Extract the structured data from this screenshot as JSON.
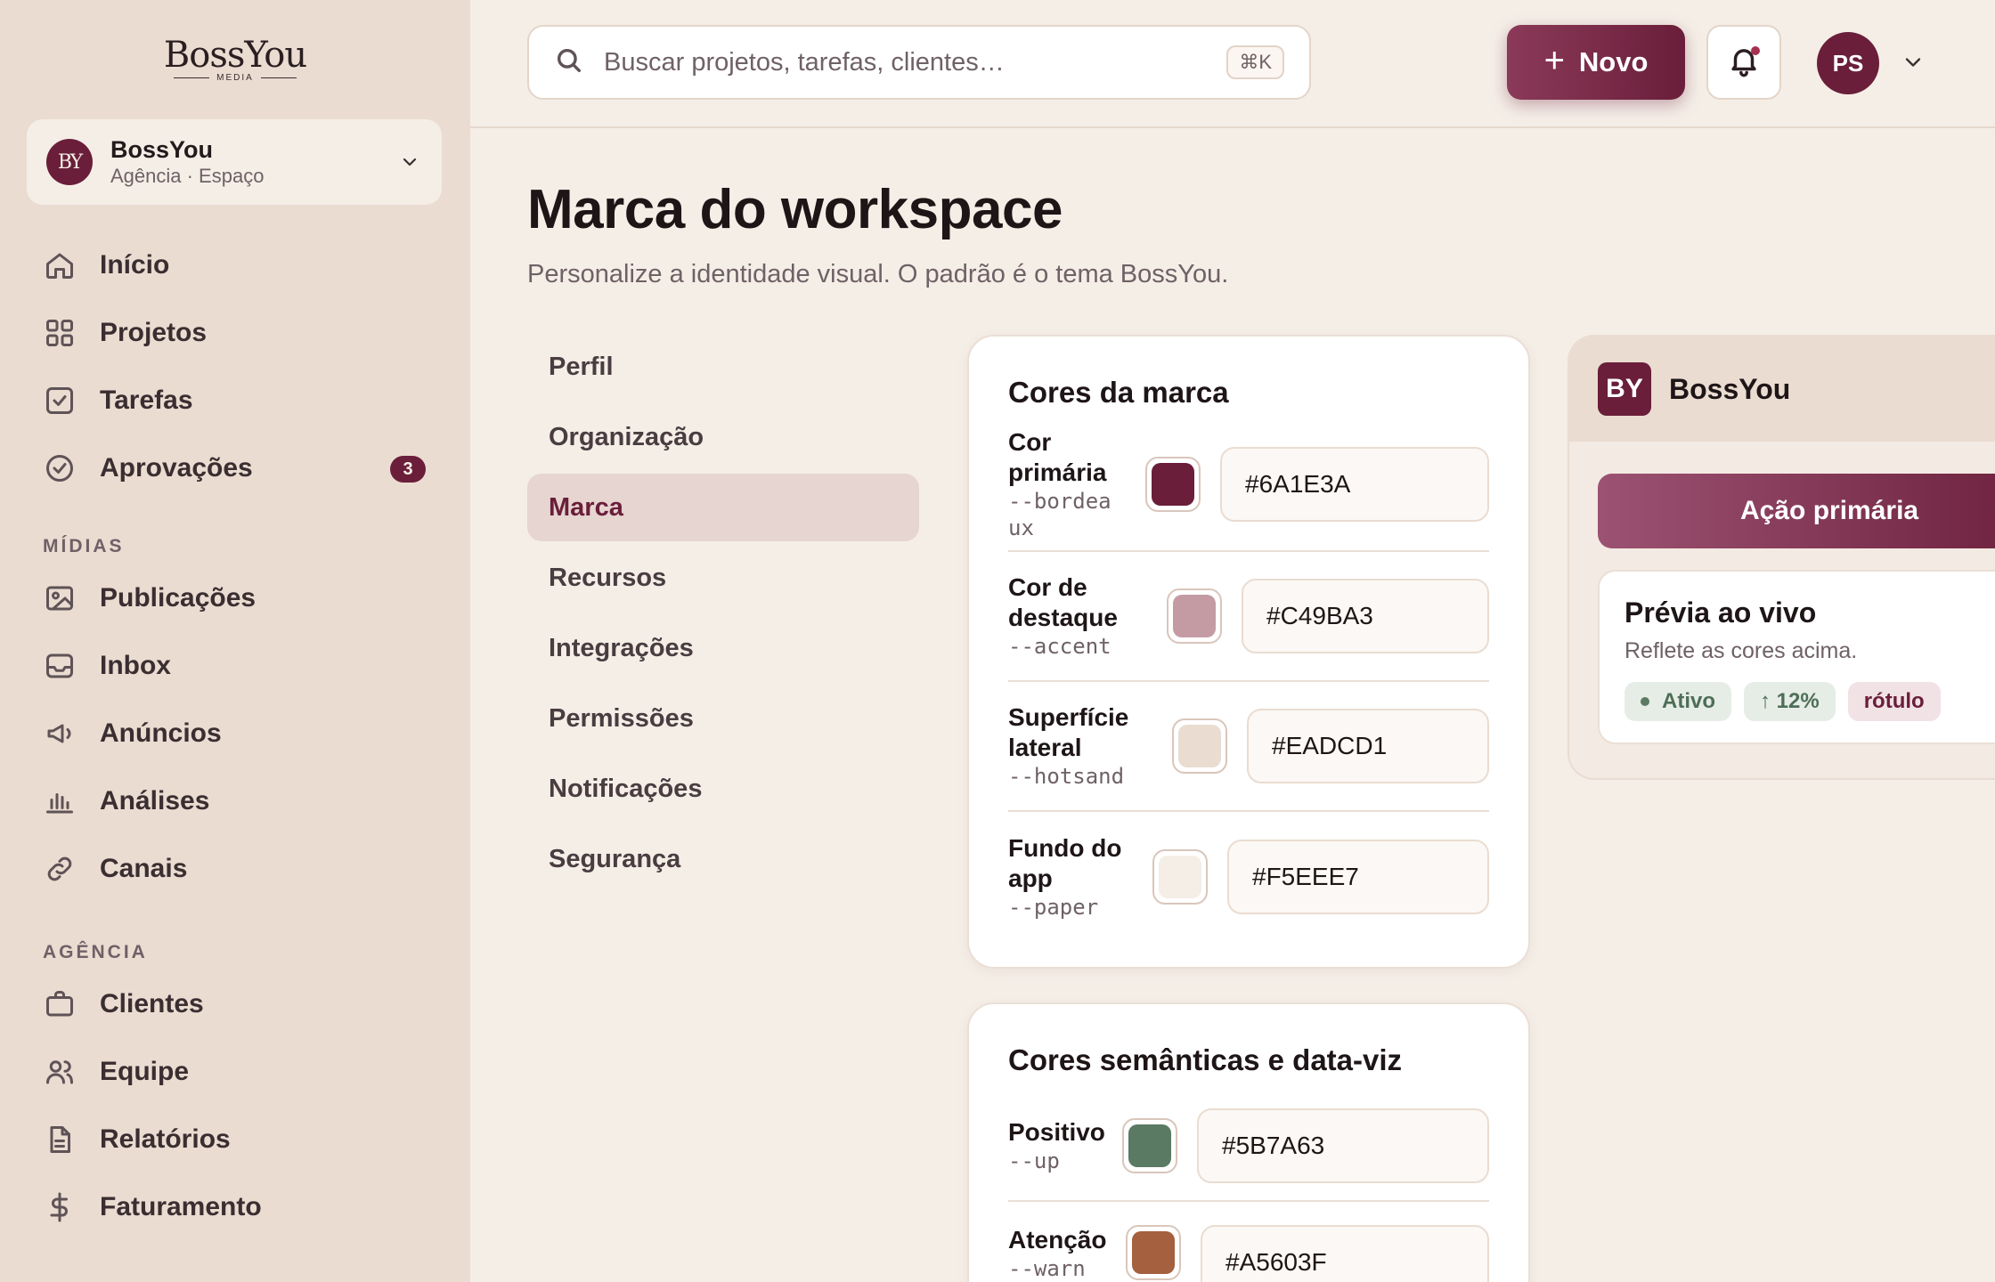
{
  "brand": {
    "wordmark": "BossYou",
    "sub": "MEDIA"
  },
  "workspace": {
    "initials": "BY",
    "name": "BossYou",
    "type": "Agência · Espaço"
  },
  "sidebar": {
    "main": [
      {
        "label": "Início",
        "icon": "home-icon"
      },
      {
        "label": "Projetos",
        "icon": "grid-icon"
      },
      {
        "label": "Tarefas",
        "icon": "checkbox-icon"
      },
      {
        "label": "Aprovações",
        "icon": "check-circle-icon",
        "badge": "3"
      }
    ],
    "media_title": "MÍDIAS",
    "media": [
      {
        "label": "Publicações",
        "icon": "image-icon"
      },
      {
        "label": "Inbox",
        "icon": "inbox-icon"
      },
      {
        "label": "Anúncios",
        "icon": "megaphone-icon"
      },
      {
        "label": "Análises",
        "icon": "bar-chart-icon"
      },
      {
        "label": "Canais",
        "icon": "link-icon"
      }
    ],
    "agency_title": "AGÊNCIA",
    "agency": [
      {
        "label": "Clientes",
        "icon": "briefcase-icon"
      },
      {
        "label": "Equipe",
        "icon": "users-icon"
      },
      {
        "label": "Relatórios",
        "icon": "document-icon"
      },
      {
        "label": "Faturamento",
        "icon": "dollar-icon"
      }
    ]
  },
  "topbar": {
    "search_placeholder": "Buscar projetos, tarefas, clientes…",
    "shortcut": "⌘K",
    "new_label": "Novo",
    "user_initials": "PS"
  },
  "page": {
    "title": "Marca do workspace",
    "subtitle": "Personalize a identidade visual. O padrão é o tema BossYou."
  },
  "settings_nav": {
    "items": [
      "Perfil",
      "Organização",
      "Marca",
      "Recursos",
      "Integrações",
      "Permissões",
      "Notificações",
      "Segurança"
    ],
    "active": "Marca"
  },
  "brand_colors": {
    "title": "Cores da marca",
    "rows": [
      {
        "name": "Cor primária",
        "var": "--bordeaux",
        "hex": "#6A1E3A"
      },
      {
        "name": "Cor de destaque",
        "var": "--accent",
        "hex": "#C49BA3"
      },
      {
        "name": "Superfície lateral",
        "var": "--hotsand",
        "hex": "#EADCD1"
      },
      {
        "name": "Fundo do app",
        "var": "--paper",
        "hex": "#F5EEE7"
      }
    ]
  },
  "semantic_colors": {
    "title": "Cores semânticas e data-viz",
    "rows": [
      {
        "name": "Positivo",
        "var": "--up",
        "hex": "#5B7A63"
      },
      {
        "name": "Atenção",
        "var": "--warn",
        "hex": "#A5603F"
      }
    ]
  },
  "preview": {
    "initials": "BY",
    "name": "BossYou",
    "primary_action": "Ação primária",
    "card_title": "Prévia ao vivo",
    "card_sub": "Reflete as cores acima.",
    "tags": {
      "status": "Ativo",
      "trend": "↑ 12%",
      "label": "rótulo"
    }
  }
}
